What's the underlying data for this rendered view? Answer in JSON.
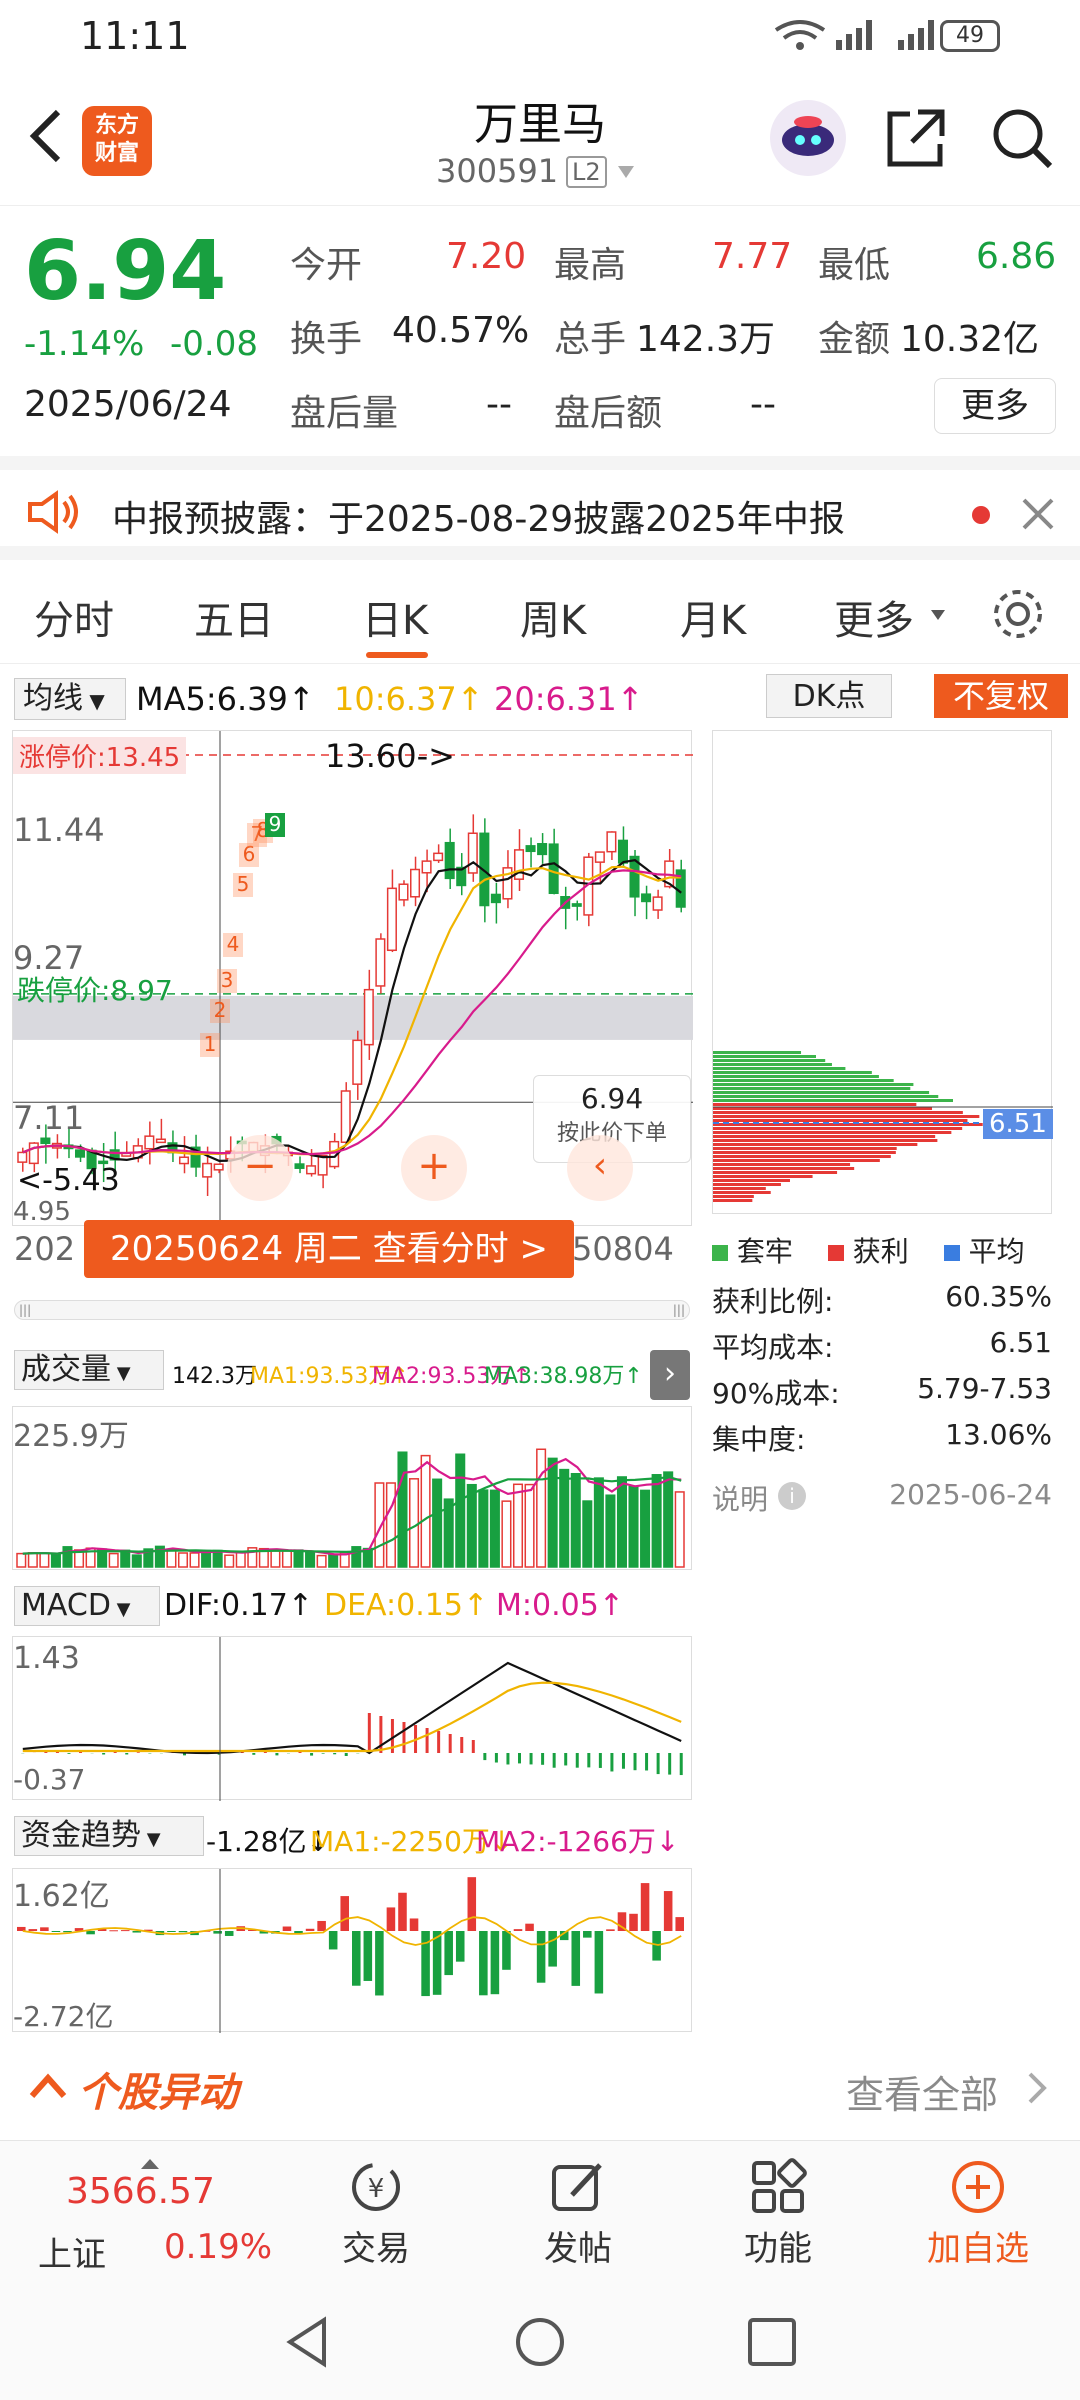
{
  "status": {
    "time": "11:11",
    "network": "4G",
    "battery": "49"
  },
  "header": {
    "brand_line1": "东方",
    "brand_line2": "财富",
    "stock_name": "万里马",
    "stock_code": "300591",
    "level_badge": "L2"
  },
  "quote": {
    "price": "6.94",
    "change_pct": "-1.14%",
    "change": "-0.08",
    "date": "2025/06/24",
    "open_label": "今开",
    "open": "7.20",
    "high_label": "最高",
    "high": "7.77",
    "low_label": "最低",
    "low": "6.86",
    "turnover_label": "换手",
    "turnover": "40.57%",
    "volume_label": "总手",
    "volume": "142.3万",
    "amount_label": "金额",
    "amount": "10.32亿",
    "after_vol_label": "盘后量",
    "after_vol": "--",
    "after_amt_label": "盘后额",
    "after_amt": "--",
    "more_label": "更多"
  },
  "notice": {
    "text": "中报预披露：于2025-08-29披露2025年中报"
  },
  "tabs": [
    "分时",
    "五日",
    "日K",
    "周K",
    "月K",
    "更多"
  ],
  "kline": {
    "ma_selector": "均线",
    "ma5": "MA5:6.39↑",
    "ma10": "10:6.37↑",
    "ma20": "20:6.31↑",
    "dk_label": "DK点",
    "fq_label": "不复权",
    "limit_up": "涨停价:13.45",
    "limit_down": "跌停价:8.97",
    "y_labels": [
      "11.44",
      "9.27",
      "7.11",
      "4.95"
    ],
    "max_marker": "13.60->",
    "min_marker": "<-5.43",
    "price_tag": "6.94",
    "order_hint": "按此价下单",
    "date_left": "202",
    "date_right": "50804",
    "date_banner": "20250624 周二 查看分时 >",
    "signals": [
      "1",
      "2",
      "3",
      "4",
      "5",
      "6",
      "7",
      "8",
      "9"
    ]
  },
  "chips": {
    "avg_tag": "6.51",
    "legend": [
      "套牢",
      "获利",
      "平均"
    ],
    "rows": [
      {
        "label": "获利比例:",
        "value": "60.35%"
      },
      {
        "label": "平均成本:",
        "value": "6.51"
      },
      {
        "label": "90%成本:",
        "value": "5.79-7.53"
      },
      {
        "label": "集中度:",
        "value": "13.06%"
      }
    ],
    "note_label": "说明",
    "note_date": "2025-06-24"
  },
  "volume": {
    "selector": "成交量",
    "v": "142.3万",
    "ma1": "MA1:93.53万↑",
    "ma2": "MA2:93.53万↑",
    "ma3": "MA3:38.98万↑",
    "ymax": "225.9万"
  },
  "macd": {
    "selector": "MACD",
    "dif": "DIF:0.17↑",
    "dea": "DEA:0.15↑",
    "m": "M:0.05↑",
    "ymax": "1.43",
    "ymin": "-0.37"
  },
  "fund": {
    "selector": "资金趋势",
    "v": "-1.28亿↓",
    "ma1": "MA1:-2250万↓",
    "ma2": "MA2:-1266万↓",
    "ymax": "1.62亿",
    "ymin": "-2.72亿"
  },
  "movers": {
    "title": "个股异动",
    "view_all": "查看全部"
  },
  "bottom": {
    "index_value": "3566.57",
    "index_name": "上证",
    "index_pct": "0.19%",
    "items": [
      "交易",
      "发帖",
      "功能",
      "加自选"
    ]
  },
  "colors": {
    "up": "#e53935",
    "down": "#18a040",
    "accent": "#ee5a1e",
    "ma5": "#111111",
    "ma10": "#f0b400",
    "ma20": "#d81b8c"
  }
}
